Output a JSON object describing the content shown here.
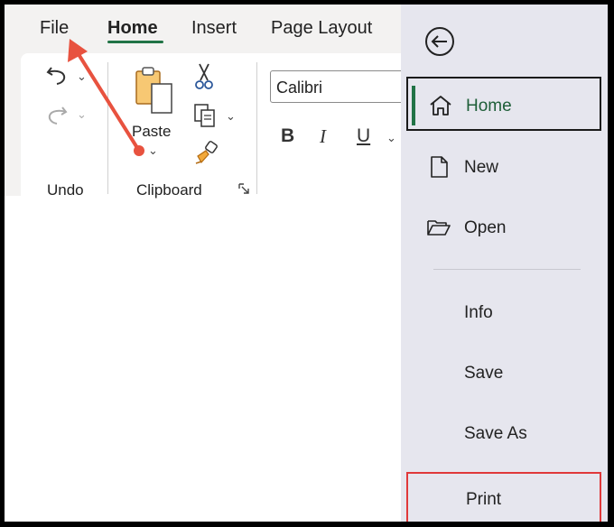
{
  "ribbon": {
    "tabs": [
      "File",
      "Home",
      "Insert",
      "Page Layout"
    ],
    "active_tab": "Home",
    "groups": {
      "undo": {
        "label": "Undo"
      },
      "clipboard": {
        "label": "Clipboard",
        "paste_label": "Paste"
      }
    },
    "font": {
      "value": "Calibri"
    },
    "format": {
      "bold": "B",
      "italic": "I",
      "underline": "U"
    }
  },
  "backstage": {
    "items": [
      {
        "label": "Home",
        "icon": "home-icon"
      },
      {
        "label": "New",
        "icon": "new-document-icon"
      },
      {
        "label": "Open",
        "icon": "folder-open-icon"
      },
      {
        "label": "Info"
      },
      {
        "label": "Save"
      },
      {
        "label": "Save As"
      },
      {
        "label": "Print"
      }
    ],
    "selected": "Home",
    "highlighted": "Print"
  },
  "annotation": {
    "arrow_color": "#e8523f",
    "print_box_color": "#e0383a"
  },
  "colors": {
    "accent": "#217346",
    "backstage_bg": "#e6e6ee",
    "ribbon_bg": "#f3f2f1"
  }
}
